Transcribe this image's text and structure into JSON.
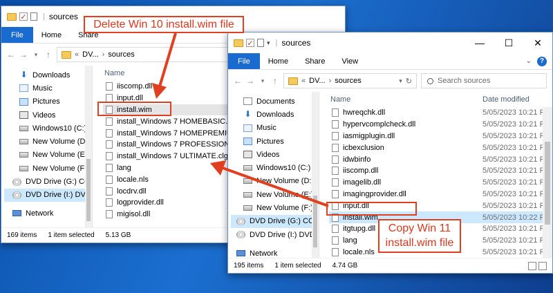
{
  "back_window": {
    "title": "sources",
    "ribbon_tabs": [
      "File",
      "Home",
      "Share",
      "View"
    ],
    "address": {
      "prefix": "«",
      "part1": "DV...",
      "part2": "sources"
    },
    "search_placeholder": "Se",
    "nav_items": [
      "Downloads",
      "Music",
      "Pictures",
      "Videos",
      "Windows10 (C:)",
      "New Volume (D:)",
      "New Volume (E:)",
      "New Volume (F:)",
      "DVD Drive (G:) CC",
      "DVD Drive (I:) DVD",
      "Network"
    ],
    "column_name": "Name",
    "files": [
      "iiscomp.dll",
      "input.dll",
      "install.wim",
      "install_Windows 7 HOMEBASIC.clg",
      "install_Windows 7 HOMEPREMIUM.clg",
      "install_Windows 7 PROFESSIONAL.clg",
      "install_Windows 7 ULTIMATE.clg",
      "lang",
      "locale.nls",
      "locdrv.dll",
      "logprovider.dll",
      "migisol.dll"
    ],
    "status": {
      "count": "169 items",
      "selected": "1 item selected",
      "size": "5.13 GB"
    }
  },
  "front_window": {
    "title": "sources",
    "ribbon_tabs": [
      "File",
      "Home",
      "Share",
      "View"
    ],
    "address": {
      "prefix": "«",
      "part1": "DV...",
      "part2": "sources"
    },
    "search_placeholder": "Search sources",
    "nav_items": [
      "Documents",
      "Downloads",
      "Music",
      "Pictures",
      "Videos",
      "Windows10 (C:)",
      "New Volume (D:)",
      "New Volume (E:)",
      "New Volume (F:)",
      "DVD Drive (G:) CC",
      "DVD Drive (I:) DVD",
      "Network"
    ],
    "column_name": "Name",
    "column_date": "Date modified",
    "files": [
      {
        "name": "hwreqchk.dll",
        "date": "5/05/2023 10:21 PM"
      },
      {
        "name": "hypervcomplcheck.dll",
        "date": "5/05/2023 10:21 PM"
      },
      {
        "name": "iasmigplugin.dll",
        "date": "5/05/2023 10:21 PM"
      },
      {
        "name": "icbexclusion",
        "date": "5/05/2023 10:21 PM"
      },
      {
        "name": "idwbinfo",
        "date": "5/05/2023 10:21 PM"
      },
      {
        "name": "iiscomp.dll",
        "date": "5/05/2023 10:21 PM"
      },
      {
        "name": "imagelib.dll",
        "date": "5/05/2023 10:21 PM"
      },
      {
        "name": "imagingprovider.dll",
        "date": "5/05/2023 10:21 PM"
      },
      {
        "name": "input.dll",
        "date": "5/05/2023 10:21 PM"
      },
      {
        "name": "install.wim",
        "date": "5/05/2023 10:22 PM"
      },
      {
        "name": "itgtupg.dll",
        "date": "5/05/2023 10:21 PM"
      },
      {
        "name": "lang",
        "date": "5/05/2023 10:21 PM"
      },
      {
        "name": "locale.nls",
        "date": "5/05/2023 10:21 PM"
      }
    ],
    "status": {
      "count": "195 items",
      "selected": "1 item selected",
      "size": "4.74 GB"
    }
  },
  "annotations": {
    "delete_label": "Delete Win 10 install.wim file",
    "copy_label_line1": "Copy Win 11",
    "copy_label_line2": "install.wim file",
    "color": "#e0401f"
  },
  "icons": [
    "folder-icon",
    "check-icon",
    "document-icon",
    "help-icon",
    "search-icon",
    "back-icon",
    "forward-icon",
    "up-icon",
    "download-icon",
    "music-icon",
    "pictures-icon",
    "videos-icon",
    "drive-icon",
    "dvd-icon",
    "network-icon"
  ]
}
